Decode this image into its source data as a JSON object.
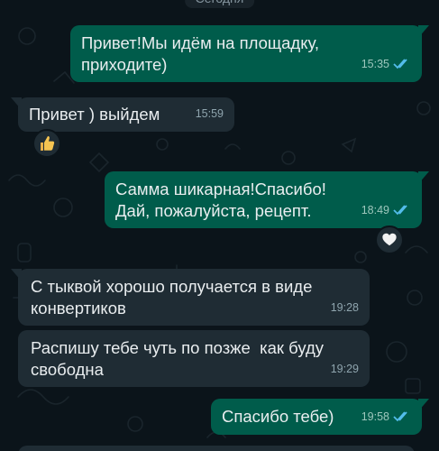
{
  "chat": {
    "date_label": "Сегодня",
    "messages": [
      {
        "direction": "outgoing",
        "text": "Привет!Мы идём на площадку,\nприходите)",
        "time": "15:35",
        "status": "read"
      },
      {
        "direction": "incoming",
        "text": "Привет ) выйдем",
        "time": "15:59",
        "reaction": "thumbs-up-icon"
      },
      {
        "direction": "outgoing",
        "text": "Самма шикарная!Спасибо!\nДай, пожалуйста, рецепт.",
        "time": "18:49",
        "status": "read",
        "reaction": "white-heart-icon"
      },
      {
        "direction": "incoming",
        "text": "С тыквой хорошо получается в виде\nконвертиков",
        "time": "19:28"
      },
      {
        "direction": "incoming",
        "text": "Распишу тебе чуть по позже  как буду\nсвободна",
        "time": "19:29"
      },
      {
        "direction": "outgoing",
        "text": "Спасибо тебе)",
        "time": "19:58",
        "status": "read"
      }
    ]
  },
  "colors": {
    "background": "#0b141a",
    "outgoing_bubble": "#005c4b",
    "incoming_bubble": "#1f2c34",
    "text": "#e9edef",
    "read_ticks": "#53bdeb"
  }
}
